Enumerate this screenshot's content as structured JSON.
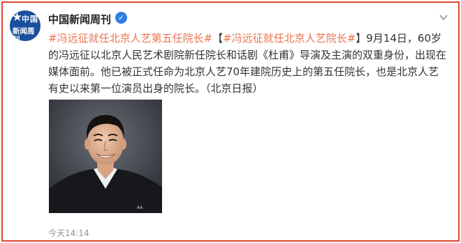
{
  "account": {
    "name": "中国新闻周刊",
    "avatar_line1": "中国",
    "avatar_line2": "新闻周刊"
  },
  "post": {
    "topic1": "#冯远征就任北京人艺第五任院长#",
    "bracket_open": "【",
    "topic2": "#冯远征就任北京人艺院长#",
    "body": "】9月14日，60岁的冯远征以北京人民艺术剧院新任院长和话剧《杜甫》导演及主演的双重身份，出现在媒体面前。他已被正式任命为北京人艺70年建院历史上的第五任院长，也是北京人艺有史以来第一位演员出身的院长。（北京日报）"
  },
  "photo": {
    "watermark": "AA"
  },
  "meta": {
    "timestamp": "今天14:14"
  },
  "colors": {
    "frame": "#e0442e",
    "topic": "#eb7350",
    "verified": "#2e7de1"
  },
  "icons": [
    "verified-icon",
    "chevron-down-icon",
    "star-icon"
  ]
}
